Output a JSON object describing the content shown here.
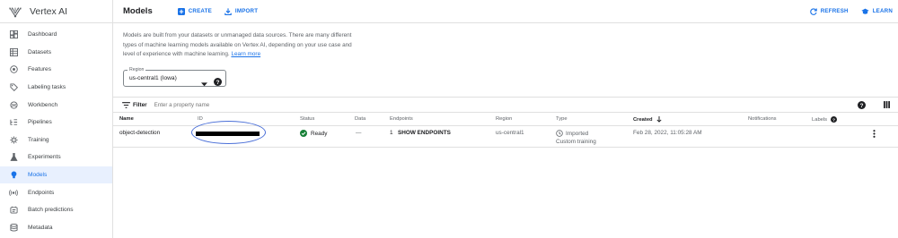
{
  "brand": {
    "title": "Vertex AI"
  },
  "sidebar": {
    "items": [
      {
        "label": "Dashboard",
        "icon": "dashboard-icon"
      },
      {
        "label": "Datasets",
        "icon": "datasets-icon"
      },
      {
        "label": "Features",
        "icon": "features-icon"
      },
      {
        "label": "Labeling tasks",
        "icon": "tag-icon"
      },
      {
        "label": "Workbench",
        "icon": "workbench-icon"
      },
      {
        "label": "Pipelines",
        "icon": "pipelines-icon"
      },
      {
        "label": "Training",
        "icon": "training-icon"
      },
      {
        "label": "Experiments",
        "icon": "flask-icon"
      },
      {
        "label": "Models",
        "icon": "lightbulb-icon",
        "active": true
      },
      {
        "label": "Endpoints",
        "icon": "endpoints-icon"
      },
      {
        "label": "Batch predictions",
        "icon": "batch-icon"
      },
      {
        "label": "Metadata",
        "icon": "metadata-icon"
      }
    ]
  },
  "header": {
    "title": "Models",
    "create_label": "CREATE",
    "import_label": "IMPORT",
    "refresh_label": "REFRESH",
    "learn_label": "LEARN"
  },
  "description": {
    "text": "Models are built from your datasets or unmanaged data sources. There are many different types of machine learning models available on Vertex AI, depending on your use case and level of experience with machine learning.",
    "link": "Learn more"
  },
  "region": {
    "label": "Region",
    "value": "us-central1 (Iowa)"
  },
  "filter": {
    "label": "Filter",
    "placeholder": "Enter a property name"
  },
  "table": {
    "columns": {
      "name": "Name",
      "id": "ID",
      "status": "Status",
      "data": "Data",
      "endpoints": "Endpoints",
      "region": "Region",
      "type": "Type",
      "created": "Created",
      "notifications": "Notifications",
      "labels": "Labels"
    },
    "rows": [
      {
        "name": "object-detection",
        "status": "Ready",
        "data": "—",
        "endpoints_count": "1",
        "endpoints_link": "SHOW ENDPOINTS",
        "region": "us-central1",
        "type_primary": "Imported",
        "type_secondary": "Custom training",
        "created": "Feb 28, 2022, 11:05:28 AM"
      }
    ]
  },
  "colors": {
    "accent": "#1a73e8",
    "ready": "#188038",
    "active_bg": "#e8f0fe"
  }
}
